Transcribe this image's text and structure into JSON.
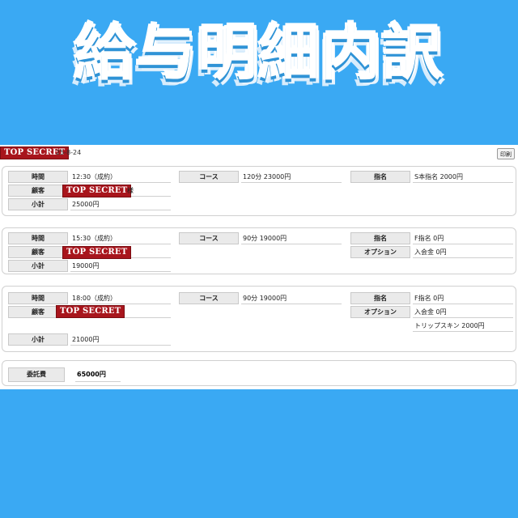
{
  "title": "給与明細内訳",
  "header": {
    "stamp": "TOP SECRET",
    "date": "25-8-24",
    "print_label": "印刷"
  },
  "labels": {
    "time": "時間",
    "customer": "顧客",
    "subtotal": "小計",
    "course": "コース",
    "nomination": "指名",
    "option": "オプション",
    "commission": "委託費"
  },
  "entries": [
    {
      "time": "12:30（成約）",
      "customer_redacted": "TOP SECRET",
      "customer_suffix": "様",
      "subtotal": "25000円",
      "course": "120分 23000円",
      "nomination": "S本指名 2000円",
      "options": []
    },
    {
      "time": "15:30（成約）",
      "customer_redacted": "TOP SECRET",
      "customer_suffix": "",
      "subtotal": "19000円",
      "course": "90分 19000円",
      "nomination": "F指名 0円",
      "options": [
        "入会金 0円"
      ]
    },
    {
      "time": "18:00（成約）",
      "customer_redacted": "TOP SECRET",
      "customer_suffix": "",
      "subtotal": "21000円",
      "course": "90分 19000円",
      "nomination": "F指名 0円",
      "options": [
        "入会金 0円",
        "トリップスキン 2000円"
      ]
    }
  ],
  "total": {
    "value": "65000円"
  },
  "colors": {
    "background": "#3aa9f3",
    "stamp": "#a8151c",
    "label_bg": "#eaeaea"
  }
}
